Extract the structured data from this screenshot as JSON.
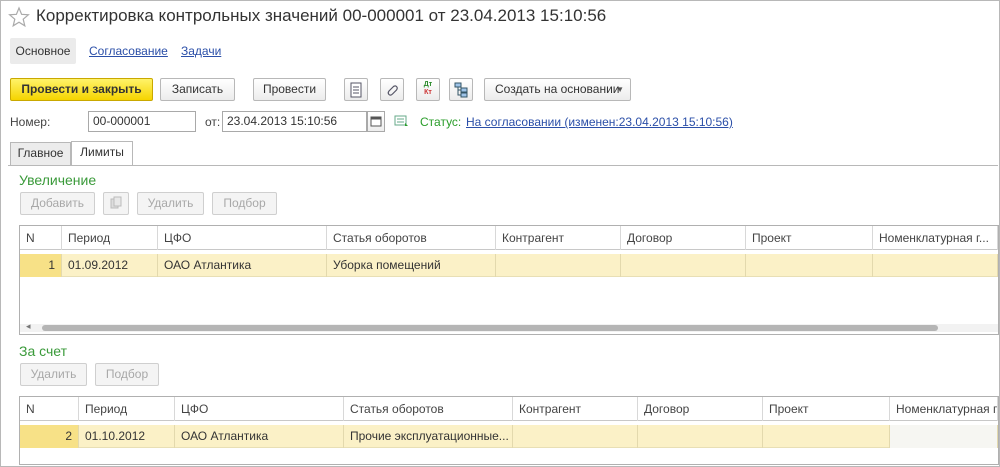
{
  "header": {
    "title": "Корректировка контрольных значений 00-000001 от 23.04.2013 15:10:56"
  },
  "nav": {
    "tabs": [
      {
        "label": "Основное",
        "active": true
      },
      {
        "label": "Согласование"
      },
      {
        "label": "Задачи"
      }
    ]
  },
  "toolbar": {
    "post_close": "Провести и закрыть",
    "save": "Записать",
    "post": "Провести",
    "dtkt_top": "Дт",
    "dtkt_bottom": "Кт",
    "create_based": "Создать на основании",
    "icons": [
      "report-icon",
      "attach-icon",
      "dt-kt-icon",
      "structure-icon"
    ]
  },
  "form": {
    "number_label": "Номер:",
    "number_value": "00-000001",
    "date_label": "от:",
    "date_value": "23.04.2013 15:10:56",
    "status_label": "Статус:",
    "status_value": "На согласовании (изменен:23.04.2013 15:10:56)"
  },
  "tabs": [
    {
      "label": "Главное"
    },
    {
      "label": "Лимиты",
      "active": true
    }
  ],
  "increase": {
    "title": "Увеличение",
    "buttons": {
      "add": "Добавить",
      "delete": "Удалить",
      "select": "Подбор"
    },
    "columns": [
      "N",
      "Период",
      "ЦФО",
      "Статья оборотов",
      "Контрагент",
      "Договор",
      "Проект",
      "Номенклатурная г..."
    ],
    "rows": [
      {
        "n": "1",
        "period": "01.09.2012",
        "cfo": "ОАО Атлантика",
        "article": "Уборка помещений",
        "contractor": "",
        "contract": "",
        "project": "",
        "nomenclature": ""
      }
    ],
    "scroll_left": "◂"
  },
  "charge": {
    "title": "За счет",
    "buttons": {
      "delete": "Удалить",
      "select": "Подбор"
    },
    "columns": [
      "N",
      "Период",
      "ЦФО",
      "Статья оборотов",
      "Контрагент",
      "Договор",
      "Проект",
      "Номенклатурная г..."
    ],
    "rows": [
      {
        "n": "2",
        "period": "01.10.2012",
        "cfo": "ОАО Атлантика",
        "article": "Прочие эксплуатационные...",
        "contractor": "",
        "contract": "",
        "project": "",
        "nomenclature": ""
      }
    ]
  },
  "colors": {
    "primary_button": "#f5d400",
    "link": "#2b4fa8",
    "section_title": "#3a9a3a",
    "row_highlight": "#fbf1c7"
  }
}
